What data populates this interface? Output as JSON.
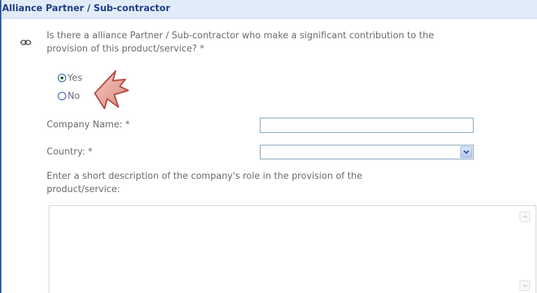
{
  "section": {
    "title": "Alliance Partner / Sub-contractor"
  },
  "question": {
    "text": "Is there a alliance Partner / Sub-contractor who make a significant contribution to the provision of this product/service? *",
    "icon": "link-icon",
    "options": [
      {
        "label": "Yes",
        "selected": true
      },
      {
        "label": "No",
        "selected": false
      }
    ]
  },
  "fields": {
    "company_label": "Company Name: *",
    "company_value": "",
    "country_label": "Country: *",
    "country_value": "",
    "description_label": "Enter a short description of the company's role in the provision of the product/service:",
    "description_value": ""
  },
  "colors": {
    "header_bg": "#e2ecf9",
    "header_text": "#1f3f86",
    "frame": "#2a5aa8",
    "label_text": "#6b6b6b",
    "input_border": "#7f9db9"
  }
}
